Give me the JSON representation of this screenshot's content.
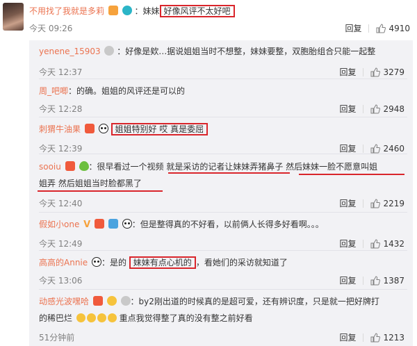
{
  "main": {
    "name": "不用找了我就是多莉",
    "sep": "：",
    "prefix": "妹妹",
    "boxed": "好像风评不太好吧",
    "time": "今天 09:26",
    "reply": "回复",
    "likes": "4910"
  },
  "replies": [
    {
      "name": "yenene_15903",
      "body": "：好像是欸…据说姐姐当时不想整，妹妹要整，双胞胎组合只能一起整",
      "time": "今天 12:37",
      "likes": "3279"
    },
    {
      "name": "周_吧唧",
      "body": "：的确。姐姐的风评还是可以的",
      "time": "今天 12:28",
      "likes": "2948"
    },
    {
      "name": "刺猬牛油果",
      "boxed": "姐姐特别好 哎 真是委屈",
      "time": "今天 12:39",
      "likes": "2460"
    },
    {
      "name": "sooiu",
      "line1": "：很早看过一个视频 就是采访的记者让妹妹弄猪鼻子 然后妹妹一脸不愿意叫姐",
      "line2": "姐弄 然后姐姐当时脸都黑了",
      "time": "今天 12:40",
      "likes": "2219"
    },
    {
      "name": "假如小one",
      "body": "：但是整得真的不好看，以前俩人长得多好看啊。。。",
      "time": "今天 12:49",
      "likes": "1432"
    },
    {
      "name": "高高的Annie",
      "body_pre": "：是的 ",
      "boxed": "妹妹有点心机的",
      "body_post": "，看她们的采访就知道了",
      "time": "今天 13:06",
      "likes": "1387"
    },
    {
      "name": "动感光波嘿哈",
      "line1": "：by2刚出道的时候真的是超可爱，还有辨识度，只是就一把好牌打",
      "line2a": "的稀巴烂",
      "line2b": "重点我觉得整了真的没有整之前好看",
      "time": "51分钟前",
      "likes": "1213"
    }
  ],
  "ui": {
    "reply_label": "回复"
  }
}
